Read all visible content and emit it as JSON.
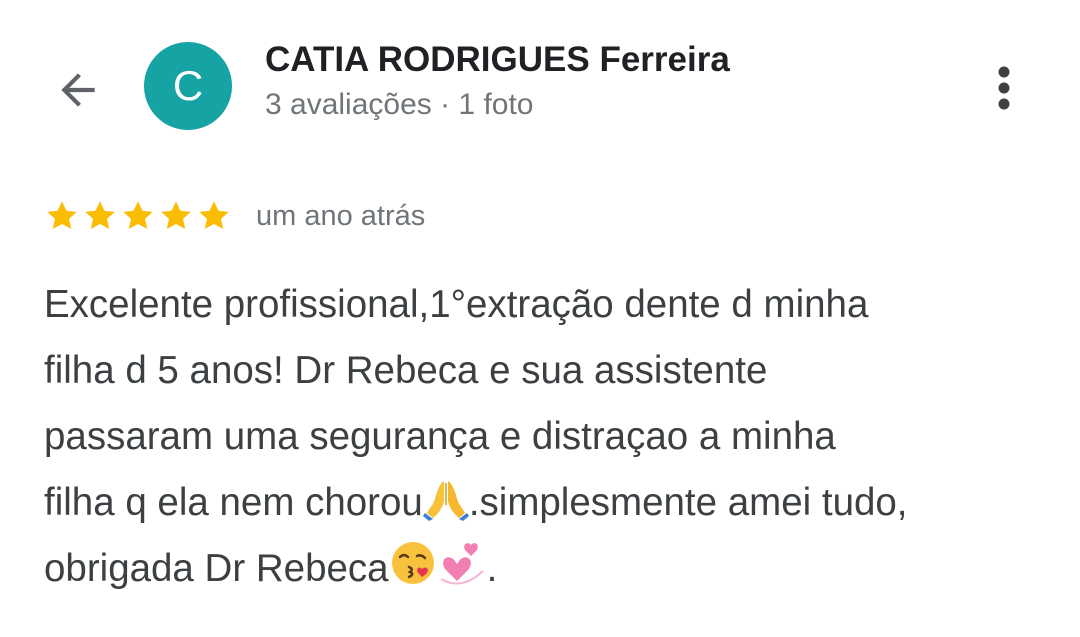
{
  "header": {
    "back_icon": "arrow-back-icon",
    "avatar_letter": "C",
    "avatar_color": "#15a3a3",
    "reviewer_name": "CATIA RODRIGUES Ferreira",
    "reviewer_meta": "3 avaliações · 1 foto",
    "more_icon": "more-vert-icon"
  },
  "review": {
    "rating": 5,
    "rating_max": 5,
    "star_color": "#fbbc04",
    "time": "um ano atrás",
    "lines": {
      "l1": "Excelente profissional,1°extração dente d minha",
      "l2": "filha d 5 anos! Dr Rebeca e sua assistente",
      "l3": "passaram uma segurança e distraçao a minha",
      "l4a": "filha q ela nem chorou",
      "l4b": ".simplesmente amei tudo,",
      "l5a": "obrigada Dr Rebeca",
      "l5b": "."
    },
    "emojis": [
      "folded-hands-emoji",
      "kissing-face-emoji",
      "revolving-hearts-emoji"
    ]
  }
}
